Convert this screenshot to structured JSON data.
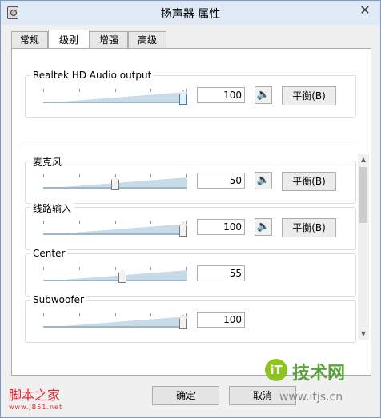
{
  "window": {
    "title": "扬声器 属性",
    "close": "✕"
  },
  "tabs": [
    {
      "label": "常规"
    },
    {
      "label": "级别"
    },
    {
      "label": "增强"
    },
    {
      "label": "高级"
    }
  ],
  "devices": {
    "main": {
      "label": "Realtek HD Audio output",
      "value": "100",
      "level": 1.0,
      "balance_label": "平衡(B)"
    },
    "mic": {
      "label": "麦克风",
      "value": "50",
      "level": 0.5,
      "balance_label": "平衡(B)"
    },
    "line_in": {
      "label": "线路输入",
      "value": "100",
      "level": 1.0,
      "balance_label": "平衡(B)"
    },
    "center": {
      "label": "Center",
      "value": "55",
      "level": 0.55
    },
    "subwoofer": {
      "label": "Subwoofer",
      "value": "100",
      "level": 1.0
    }
  },
  "buttons": {
    "ok": "确定",
    "cancel": "取消"
  },
  "watermarks": {
    "left_main": "脚本之家",
    "left_url": "www.JB51.net",
    "logo_glyph": "iT",
    "right_main": "技术网",
    "right_url": "www.itjs.cn"
  },
  "icons": {
    "speaker": "🔈"
  },
  "colors": {
    "accent": "#1e5fa8",
    "watermark_red": "#d9282f",
    "watermark_green": "#5aa23c"
  }
}
